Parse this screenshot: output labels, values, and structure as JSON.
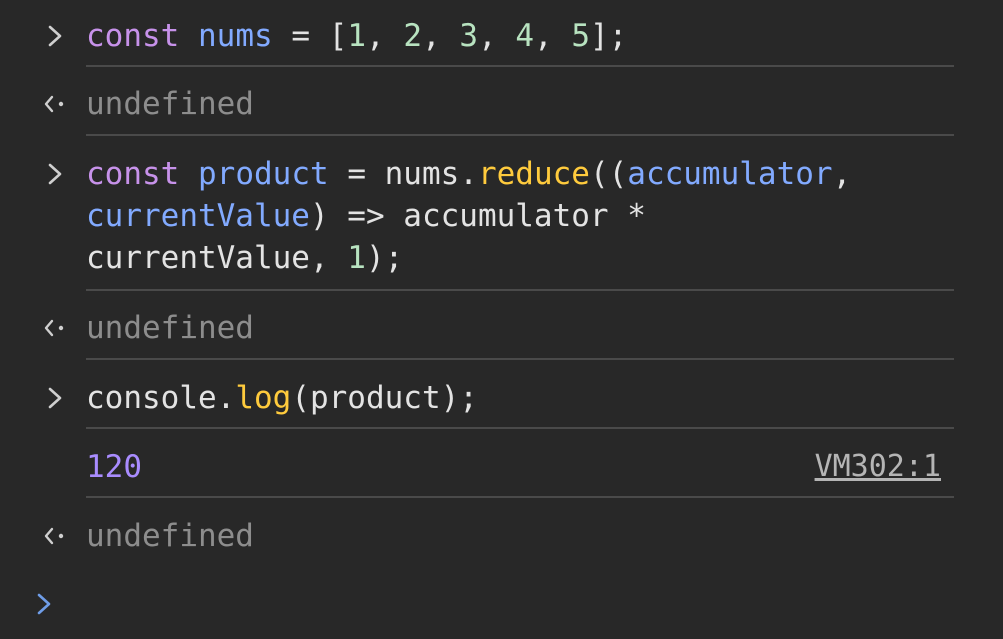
{
  "console": {
    "entries": [
      {
        "type": "input",
        "prompt_icon": "chevron-right-icon",
        "lines": [
          {
            "tokens": [
              {
                "text": "const",
                "kind": "keyword"
              },
              {
                "text": " ",
                "kind": "plain"
              },
              {
                "text": "nums",
                "kind": "variable"
              },
              {
                "text": " = [",
                "kind": "plain"
              },
              {
                "text": "1",
                "kind": "number"
              },
              {
                "text": ", ",
                "kind": "plain"
              },
              {
                "text": "2",
                "kind": "number"
              },
              {
                "text": ", ",
                "kind": "plain"
              },
              {
                "text": "3",
                "kind": "number"
              },
              {
                "text": ", ",
                "kind": "plain"
              },
              {
                "text": "4",
                "kind": "number"
              },
              {
                "text": ", ",
                "kind": "plain"
              },
              {
                "text": "5",
                "kind": "number"
              },
              {
                "text": "];",
                "kind": "plain"
              }
            ]
          }
        ]
      },
      {
        "type": "result",
        "result_icon": "return-arrow-icon",
        "text": "undefined"
      },
      {
        "type": "input",
        "prompt_icon": "chevron-right-icon",
        "lines": [
          {
            "tokens": [
              {
                "text": "const",
                "kind": "keyword"
              },
              {
                "text": " ",
                "kind": "plain"
              },
              {
                "text": "product",
                "kind": "variable"
              },
              {
                "text": " = nums.",
                "kind": "plain"
              },
              {
                "text": "reduce",
                "kind": "function"
              },
              {
                "text": "((",
                "kind": "plain"
              },
              {
                "text": "accumulator",
                "kind": "variable"
              },
              {
                "text": ",",
                "kind": "plain"
              }
            ]
          },
          {
            "tokens": [
              {
                "text": "currentValue",
                "kind": "variable"
              },
              {
                "text": ") => accumulator *",
                "kind": "plain"
              }
            ]
          },
          {
            "tokens": [
              {
                "text": "currentValue, ",
                "kind": "plain"
              },
              {
                "text": "1",
                "kind": "number"
              },
              {
                "text": ");",
                "kind": "plain"
              }
            ]
          }
        ]
      },
      {
        "type": "result",
        "result_icon": "return-arrow-icon",
        "text": "undefined"
      },
      {
        "type": "input",
        "prompt_icon": "chevron-right-icon",
        "lines": [
          {
            "tokens": [
              {
                "text": "console.",
                "kind": "plain"
              },
              {
                "text": "log",
                "kind": "function"
              },
              {
                "text": "(product);",
                "kind": "plain"
              }
            ]
          }
        ]
      },
      {
        "type": "output",
        "text": "120",
        "source": "VM302:1"
      },
      {
        "type": "result",
        "result_icon": "return-arrow-icon",
        "text": "undefined"
      }
    ],
    "active_prompt_icon": "chevron-right-icon"
  },
  "colors": {
    "background": "#282828",
    "keyword": "#c792ea",
    "variable": "#82aaff",
    "function": "#ffcb3d",
    "number": "#b8e3c0",
    "plain": "#e3e3e3",
    "muted": "#8d8d8d",
    "output_number": "#a98cff",
    "separator": "#4a4a4a",
    "active_prompt": "#6f9de8"
  }
}
